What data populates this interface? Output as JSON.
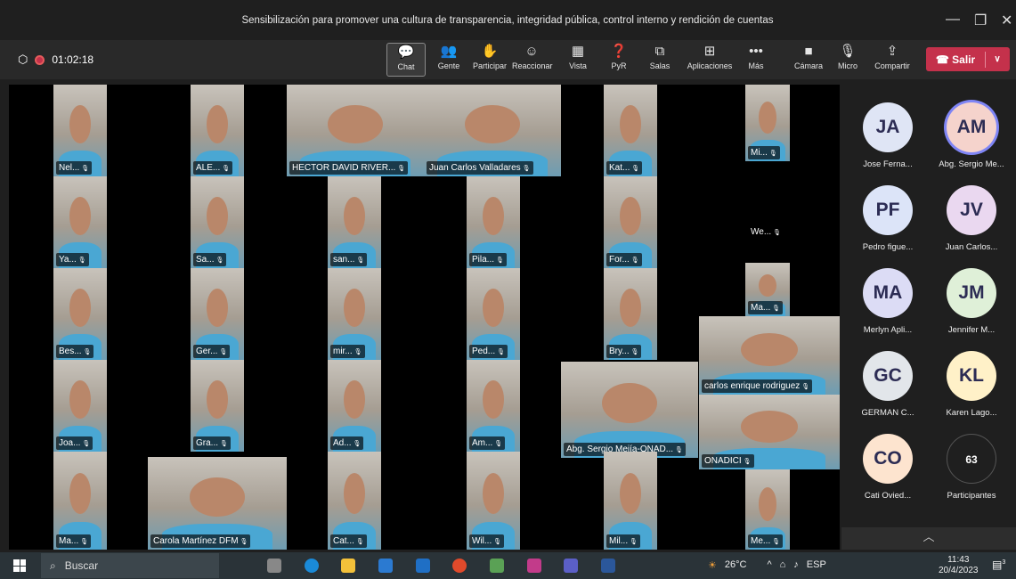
{
  "window": {
    "title": "Sensibilización para promover una cultura de transparencia, integridad pública, control interno y rendición de cuentas",
    "minimize": "—",
    "maximize": "❐",
    "close": "✕"
  },
  "meeting": {
    "timer": "01:02:18"
  },
  "toolbar": {
    "items": [
      {
        "label": "Chat",
        "icon": "chat-icon",
        "glyph": "💬"
      },
      {
        "label": "Gente",
        "icon": "people-icon",
        "glyph": "👥"
      },
      {
        "label": "Participar",
        "icon": "raise-hand-icon",
        "glyph": "✋"
      },
      {
        "label": "Reaccionar",
        "icon": "smiley-icon",
        "glyph": "☺"
      },
      {
        "label": "Vista",
        "icon": "grid-icon",
        "glyph": "▦"
      },
      {
        "label": "PyR",
        "icon": "qa-icon",
        "glyph": "❓"
      },
      {
        "label": "Salas",
        "icon": "rooms-icon",
        "glyph": "⧉"
      },
      {
        "label": "Aplicaciones",
        "icon": "add-apps-icon",
        "glyph": "⊞"
      },
      {
        "label": "Más",
        "icon": "more-icon",
        "glyph": "•••"
      },
      {
        "label": "Cámara",
        "icon": "camera-icon",
        "glyph": "■"
      },
      {
        "label": "Micro",
        "icon": "mic-off-icon",
        "glyph": "🎙"
      },
      {
        "label": "Compartir",
        "icon": "share-icon",
        "glyph": "⇪"
      }
    ],
    "leave": "Salir"
  },
  "video_tiles": [
    {
      "name": "Nel..."
    },
    {
      "name": "ALE..."
    },
    {
      "name": "HECTOR DAVID RIVER..."
    },
    {
      "name": "Juan Carlos Valladares"
    },
    {
      "name": "Kat..."
    },
    {
      "name": "Mi..."
    },
    {
      "name": "Ya..."
    },
    {
      "name": "Sa..."
    },
    {
      "name": "san..."
    },
    {
      "name": "Pila..."
    },
    {
      "name": "For..."
    },
    {
      "name": "We..."
    },
    {
      "name": "Bes..."
    },
    {
      "name": "Ger..."
    },
    {
      "name": "mir..."
    },
    {
      "name": "Ped..."
    },
    {
      "name": "Bry..."
    },
    {
      "name": "Ma..."
    },
    {
      "name": "carlos enrique rodriguez"
    },
    {
      "name": "Joa..."
    },
    {
      "name": "Gra..."
    },
    {
      "name": "Ad..."
    },
    {
      "name": "Am..."
    },
    {
      "name": "Abg. Sergio Mejía-ONAD..."
    },
    {
      "name": "ONADICI"
    },
    {
      "name": "Ma..."
    },
    {
      "name": "Carola Martínez DFM"
    },
    {
      "name": "Cat..."
    },
    {
      "name": "Wil..."
    },
    {
      "name": "Mil..."
    },
    {
      "name": "Me..."
    }
  ],
  "participants": [
    {
      "initials": "JA",
      "name": "Jose Ferna...",
      "color": "#dfe5f5"
    },
    {
      "initials": "AM",
      "name": "Abg. Sergio Me...",
      "color": "#f5d3cc"
    },
    {
      "initials": "PF",
      "name": "Pedro figue...",
      "color": "#dce4f8"
    },
    {
      "initials": "JV",
      "name": "Juan Carlos...",
      "color": "#ead8f0"
    },
    {
      "initials": "MA",
      "name": "Merlyn Apli...",
      "color": "#dcdcf5"
    },
    {
      "initials": "JM",
      "name": "Jennifer M...",
      "color": "#dff0d8"
    },
    {
      "initials": "GC",
      "name": "GERMAN C...",
      "color": "#e2e6ea"
    },
    {
      "initials": "KL",
      "name": "Karen Lago...",
      "color": "#fff1c8"
    },
    {
      "initials": "CO",
      "name": "Cati Ovied...",
      "color": "#fde4cf"
    },
    {
      "initials": "63",
      "name": "Participantes",
      "color": "#1f1f1f"
    }
  ],
  "taskbar": {
    "search": "Buscar",
    "temp": "26°C",
    "lang": "ESP",
    "time": "11:43",
    "date": "20/4/2023",
    "notif": "3"
  }
}
